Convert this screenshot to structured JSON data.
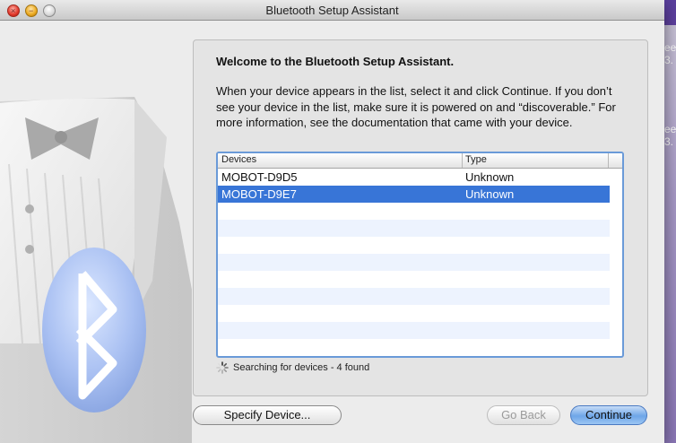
{
  "window": {
    "title": "Bluetooth Setup Assistant"
  },
  "desktop": {
    "fragments": [
      "ee",
      "3.",
      "ee",
      "3."
    ]
  },
  "panel": {
    "heading": "Welcome to the Bluetooth Setup Assistant.",
    "instructions": "When your device appears in the list, select it and click Continue. If you don’t see your device in the list, make sure it is powered on and “discoverable.” For more information, see the documentation that came with your device."
  },
  "device_list": {
    "columns": [
      "Devices",
      "Type"
    ],
    "rows": [
      {
        "device": "MOBOT-D9D5",
        "type": "Unknown"
      },
      {
        "device": "MOBOT-D9E7",
        "type": "Unknown"
      }
    ],
    "selected_device": "MOBOT-D9E7"
  },
  "status": {
    "text": "Searching for devices - 4 found"
  },
  "buttons": {
    "specify_device": "Specify Device...",
    "go_back": "Go Back",
    "continue": "Continue"
  },
  "colors": {
    "selection": "#3875d7",
    "default_button": "#6ea6e8",
    "list_focus_ring": "#6a9ad8"
  }
}
